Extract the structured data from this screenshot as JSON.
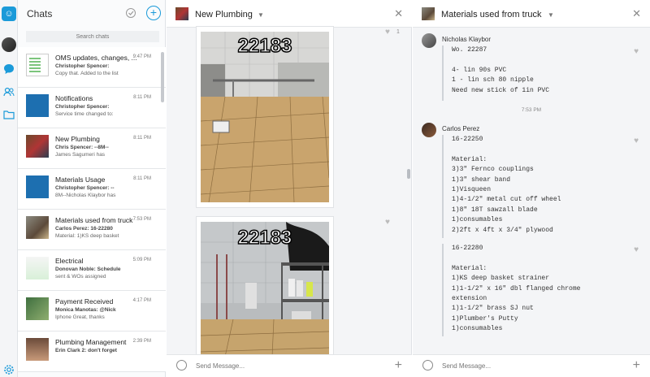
{
  "rail": {
    "logo": "☺",
    "icons": [
      "chat-bubble-icon",
      "people-icon",
      "folder-icon",
      "gear-icon"
    ]
  },
  "chats": {
    "title": "Chats",
    "search_placeholder": "Search chats",
    "items": [
      {
        "name": "OMS updates, changes, ...",
        "time": "9:47 PM",
        "sender": "Christopher Spencer:",
        "preview": "Copy that. Added to the list"
      },
      {
        "name": "Notifications",
        "time": "8:11 PM",
        "sender": "Christopher Spencer:",
        "preview": "Service time changed to:"
      },
      {
        "name": "New Plumbing",
        "time": "8:11 PM",
        "sender": "Chris Spencer: --8M--",
        "preview": "James Sagumeri has"
      },
      {
        "name": "Materials Usage",
        "time": "8:11 PM",
        "sender": "Christopher Spencer: --",
        "preview": "8M--Nicholas Klaybor has"
      },
      {
        "name": "Materials used from truck",
        "time": "7:53 PM",
        "sender": "Carlos Perez: 16-22280",
        "preview": "Material: 1)KS deep basket"
      },
      {
        "name": "Electrical",
        "time": "5:09 PM",
        "sender": "Donovan Noble: Schedule",
        "preview": "sent & WOs assigned"
      },
      {
        "name": "Payment Received",
        "time": "4:17 PM",
        "sender": "Monica Manotas: @Nick",
        "preview": "Iphone Great, thanks"
      },
      {
        "name": "Plumbing Management",
        "time": "2:39 PM",
        "sender": "Erin Clark 2: don't forget",
        "preview": ""
      }
    ]
  },
  "middle": {
    "title": "New Plumbing",
    "photos": [
      {
        "label": "22183",
        "likes": "1"
      },
      {
        "label": "22183",
        "likes": ""
      }
    ],
    "composer_placeholder": "Send Message..."
  },
  "right": {
    "title": "Materials used from truck",
    "messages": [
      {
        "author": "Nicholas Klaybor",
        "body": "Wo. 22287\n\n4- lin 90s PVC\n1 - lin sch 80 nipple\nNeed new stick of 1in PVC"
      },
      {
        "timestamp": "7:53 PM"
      },
      {
        "author": "Carlos Perez",
        "body": "16-22250\n\nMaterial:\n3)3\" Fernco couplings\n1)3\" shear band\n1)Visqueen\n1)4-1/2\" metal cut off wheel\n1)8\" 18T sawzall blade\n1)consumables\n2)2ft x 4ft x 3/4\" plywood"
      },
      {
        "body": "16-22280\n\nMaterial:\n1)KS deep basket strainer\n1)1-1/2\" x 16\" dbl flanged chrome\nextension\n1)1-1/2\" brass SJ nut\n1)Plumber's Putty\n1)consumables"
      }
    ],
    "composer_placeholder": "Send Message..."
  },
  "colors": {
    "accent": "#1a9ad9",
    "background": "#f4f5f7"
  }
}
